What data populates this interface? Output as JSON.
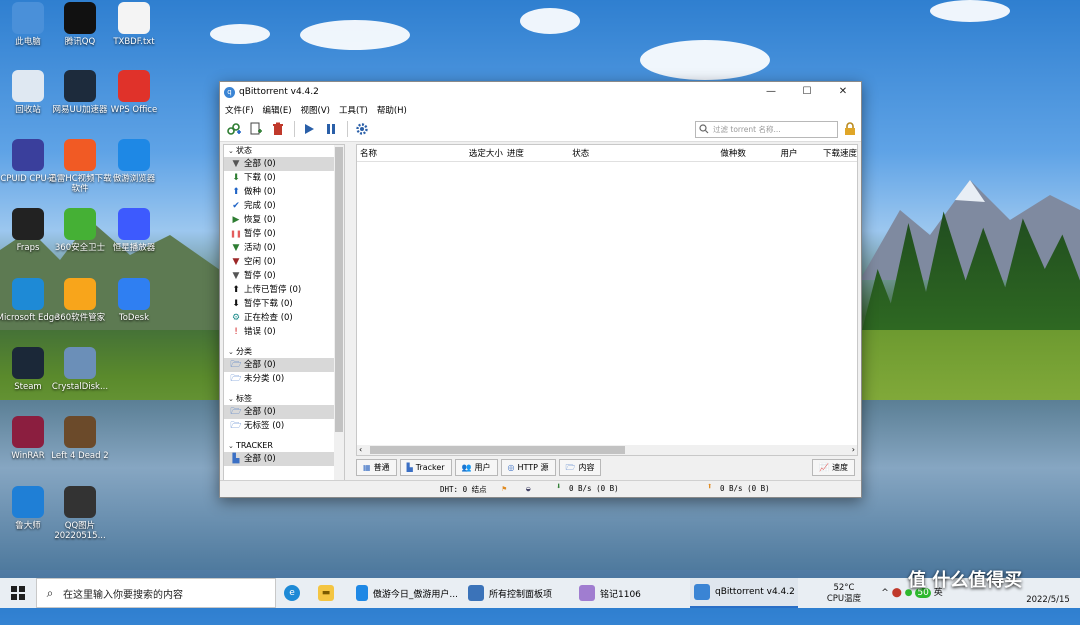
{
  "desktop": {
    "icons": [
      {
        "label": "此电脑",
        "icon": "computer-icon",
        "color": "#4a90d9"
      },
      {
        "label": "腾讯QQ",
        "icon": "qq-icon",
        "color": "#111111"
      },
      {
        "label": "TXBDF.txt",
        "icon": "text-file-icon",
        "color": "#f4f4f4"
      },
      {
        "label": "回收站",
        "icon": "recycle-bin-icon",
        "color": "#dfe8f2"
      },
      {
        "label": "网易UU加速器",
        "icon": "uu-accelerator-icon",
        "color": "#1d2b3c"
      },
      {
        "label": "WPS Office",
        "icon": "wps-office-icon",
        "color": "#e0322a"
      },
      {
        "label": "CPUID CPU-Z",
        "icon": "cpuz-icon",
        "color": "#3a3f9c"
      },
      {
        "label": "迅雷HC视频下载软件",
        "icon": "video-downloader-icon",
        "color": "#f15a24"
      },
      {
        "label": "傲游浏览器",
        "icon": "maxthon-browser-icon",
        "color": "#1e88e5"
      },
      {
        "label": "Fraps",
        "icon": "fraps-icon",
        "color": "#222222"
      },
      {
        "label": "360安全卫士",
        "icon": "360-security-icon",
        "color": "#45b035"
      },
      {
        "label": "恒星播放器",
        "icon": "player-icon",
        "color": "#3d5afe"
      },
      {
        "label": "Microsoft Edge",
        "icon": "edge-icon",
        "color": "#1e8ad6"
      },
      {
        "label": "360软件管家",
        "icon": "360-manager-icon",
        "color": "#f8a51b"
      },
      {
        "label": "ToDesk",
        "icon": "todesk-icon",
        "color": "#2f7ff2"
      },
      {
        "label": "Steam",
        "icon": "steam-icon",
        "color": "#1b2838"
      },
      {
        "label": "CrystalDisk...",
        "icon": "crystaldisk-icon",
        "color": "#6b8fb8"
      },
      {
        "label": "WinRAR",
        "icon": "winrar-icon",
        "color": "#8b1e3f"
      },
      {
        "label": "Left 4 Dead 2",
        "icon": "left4dead-icon",
        "color": "#6b4a2a"
      },
      {
        "label": "鲁大师",
        "icon": "ludashi-icon",
        "color": "#1f7fd6"
      },
      {
        "label": "QQ图片20220515...",
        "icon": "image-file-icon",
        "color": "#333333"
      }
    ]
  },
  "window": {
    "title": "qBittorrent v4.4.2",
    "controls": {
      "minimize": "—",
      "maximize": "☐",
      "close": "✕"
    },
    "menu": [
      "文件(F)",
      "编辑(E)",
      "视图(V)",
      "工具(T)",
      "帮助(H)"
    ],
    "search_placeholder": "过滤 torrent 名称...",
    "sidebar": {
      "status_header": "状态",
      "status_items": [
        {
          "label": "全部 (0)",
          "icon": "filter-icon",
          "color": "#555555"
        },
        {
          "label": "下载 (0)",
          "icon": "download-arrow-icon",
          "color": "#2e7d32"
        },
        {
          "label": "做种 (0)",
          "icon": "upload-arrow-icon",
          "color": "#1e63c6"
        },
        {
          "label": "完成 (0)",
          "icon": "checkmark-icon",
          "color": "#1e63c6"
        },
        {
          "label": "恢复 (0)",
          "icon": "play-icon",
          "color": "#2e7d32"
        },
        {
          "label": "暂停 (0)",
          "icon": "pause-icon",
          "color": "#e35d5d"
        },
        {
          "label": "活动 (0)",
          "icon": "active-filter-icon",
          "color": "#2e7d32"
        },
        {
          "label": "空闲 (0)",
          "icon": "idle-filter-icon",
          "color": "#9c2727"
        },
        {
          "label": "暂停 (0)",
          "icon": "stalled-filter-icon",
          "color": "#555555"
        },
        {
          "label": "上传已暂停 (0)",
          "icon": "upload-paused-icon",
          "color": "#111111"
        },
        {
          "label": "暂停下载 (0)",
          "icon": "download-paused-icon",
          "color": "#111111"
        },
        {
          "label": "正在检查 (0)",
          "icon": "checking-gear-icon",
          "color": "#1a8a8a"
        },
        {
          "label": "错误 (0)",
          "icon": "error-icon",
          "color": "#d01818"
        }
      ],
      "category_header": "分类",
      "category_items": [
        {
          "label": "全部 (0)"
        },
        {
          "label": "未分类 (0)"
        }
      ],
      "tags_header": "标签",
      "tag_items": [
        {
          "label": "全部 (0)"
        },
        {
          "label": "无标签 (0)"
        }
      ],
      "tracker_header": "TRACKER",
      "tracker_items": [
        {
          "label": "全部 (0)"
        }
      ]
    },
    "columns": [
      "名称",
      "选定大小",
      "进度",
      "状态",
      "做种数",
      "用户",
      "下载速度"
    ],
    "tabs": [
      "普通",
      "Tracker",
      "用户",
      "HTTP 源",
      "内容"
    ],
    "speed_tab": "速度",
    "statusbar": {
      "dht": "DHT: 0 结点",
      "download": "0 B/s (0 B)",
      "upload": "0 B/s (0 B)"
    }
  },
  "taskbar": {
    "search_placeholder": "在这里输入你要搜索的内容",
    "apps": [
      {
        "label": "傲游今日_傲游用户...",
        "icon": "maxthon-icon",
        "color": "#1e88e5"
      },
      {
        "label": "所有控制面板项",
        "icon": "control-panel-icon",
        "color": "#3b73b9"
      },
      {
        "label": "铭记1106",
        "icon": "avatar-icon",
        "color": "#a07dd0"
      },
      {
        "label": "qBittorrent v4.4.2",
        "icon": "qbittorrent-icon",
        "color": "#3a84d4"
      }
    ],
    "temperature": "52°C",
    "temperature_label": "CPU温度",
    "ime": "英",
    "badge": "50",
    "date": "2022/5/15",
    "watermark": "值 什么值得买"
  }
}
